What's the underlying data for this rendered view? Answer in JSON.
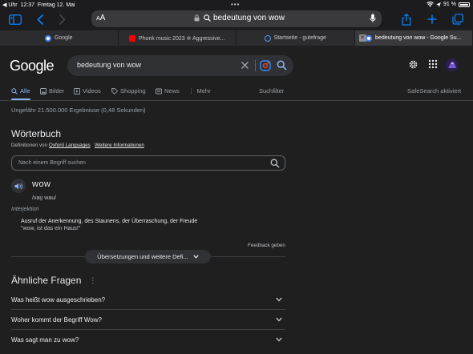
{
  "status_bar": {
    "carrier": "◀ Uhr",
    "time": "12:37",
    "date": "Freitag 12. Mai",
    "battery": "91 %"
  },
  "toolbar": {
    "text_size_label": "AA",
    "url": "bedeutung von wow"
  },
  "tabs": [
    {
      "label": "Google",
      "favicon_color": "#ffffff"
    },
    {
      "label": "Phonk music 2023 ※ Aggressive...",
      "favicon_color": "#ff0000"
    },
    {
      "label": "Startseite - gutefrage",
      "favicon_color": "#4f9cff"
    },
    {
      "label": "bedeutung von wow - Google Su...",
      "favicon_color": "#ffffff"
    }
  ],
  "google": {
    "logo": "Google",
    "query": "bedeutung von wow"
  },
  "nav": {
    "items": [
      "Alle",
      "Bilder",
      "Videos",
      "Shopping",
      "News",
      "Mehr"
    ],
    "tools": "Suchfilter",
    "safesearch": "SafeSearch aktiviert"
  },
  "results_stats": "Ungefähr 21.500.000 Ergebnisse (0,48 Sekunden)",
  "dictionary": {
    "title": "Wörterbuch",
    "source_prefix": "Definitionen von",
    "source_link": "Oxford Languages",
    "more_info": "Weitere Informationen",
    "search_placeholder": "Nach einem Begriff suchen",
    "word": "wow",
    "phonetic": "/vaʊ̯ wau/",
    "word_class": "Interjektion",
    "definition": "Ausruf der Anerkennung, des Staunens, der Überraschung, der Freude",
    "example": "\"wow, ist das ein Haus!\"",
    "feedback": "Feedback geben",
    "more_button": "Übersetzungen und weitere Defi..."
  },
  "related": {
    "title": "Ähnliche Fragen",
    "questions": [
      "Was heißt wow ausgeschrieben?",
      "Woher kommt der Begriff Wow?",
      "Was sagt man zu wow?"
    ]
  },
  "colors": {
    "accent": "#8ab4f8",
    "safari_blue": "#0a84ff",
    "background": "#1f1f1f"
  }
}
